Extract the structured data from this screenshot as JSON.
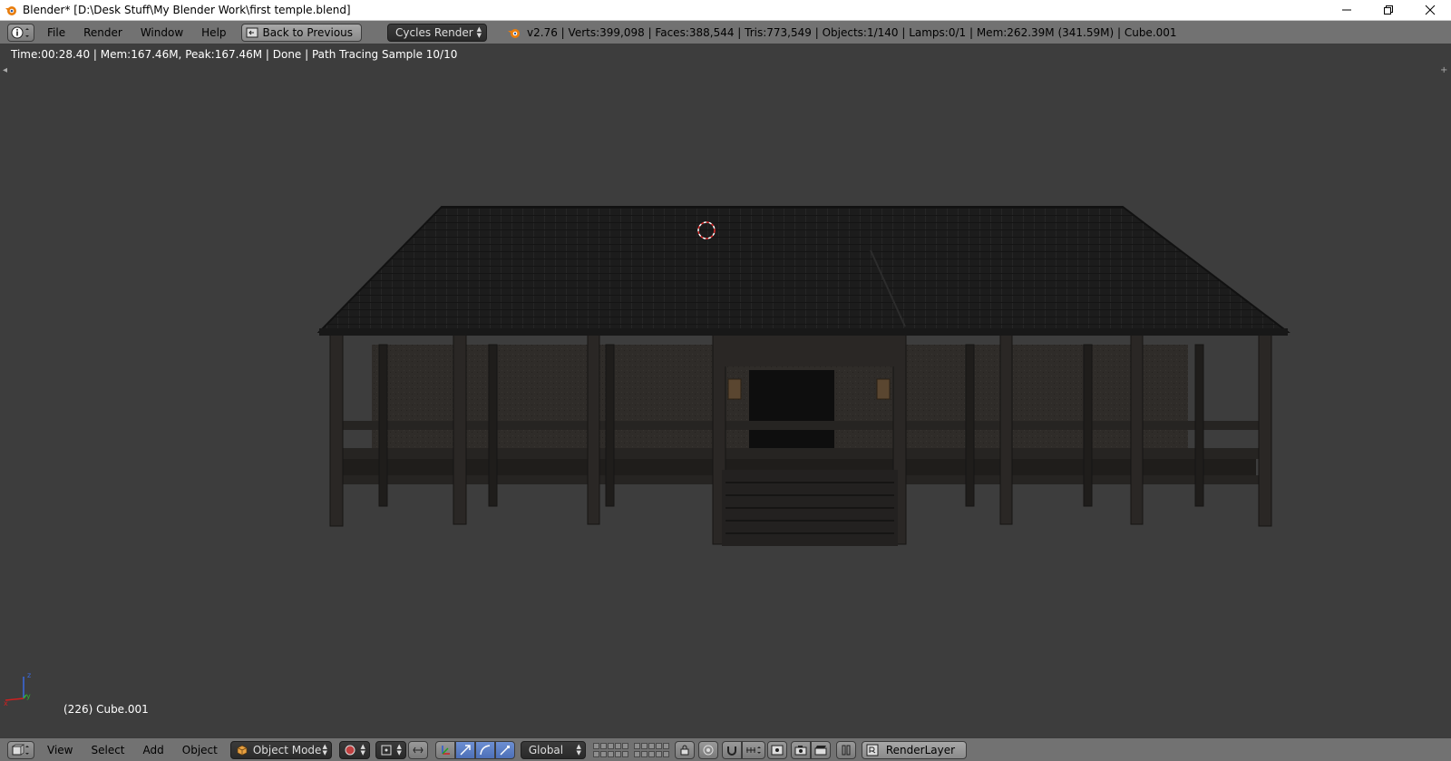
{
  "window": {
    "title": "Blender* [D:\\Desk Stuff\\My Blender Work\\first temple.blend]",
    "controls": [
      "minimize-icon",
      "restore-icon",
      "close-icon"
    ]
  },
  "info_header": {
    "menus": [
      "File",
      "Render",
      "Window",
      "Help"
    ],
    "back_button": "Back to Previous",
    "render_engine": "Cycles Render",
    "stats": "v2.76 | Verts:399,098 | Faces:388,544 | Tris:773,549 | Objects:1/140 | Lamps:0/1 | Mem:262.39M (341.59M) | Cube.001"
  },
  "render_status": "Time:00:28.40 | Mem:167.46M, Peak:167.46M | Done | Path Tracing Sample 10/10",
  "viewport": {
    "object_label": "(226) Cube.001",
    "axes": {
      "z": "z",
      "y": "y",
      "x": "x"
    },
    "colors": {
      "background": "#3d3d3d",
      "roof": "#1c1c1c",
      "wood": "#262422",
      "wall": "#2e2b28",
      "cursor": "#e03030"
    }
  },
  "view3d_header": {
    "menus": [
      "View",
      "Select",
      "Add",
      "Object"
    ],
    "mode": "Object Mode",
    "orientation": "Global",
    "render_layer": "RenderLayer"
  }
}
